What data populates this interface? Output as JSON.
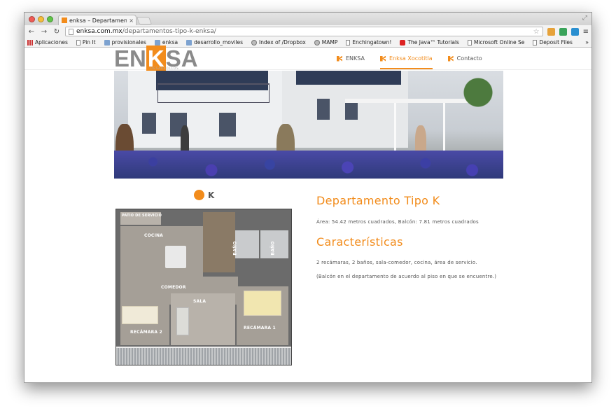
{
  "browser": {
    "tab_title": "enksa – Departamentos tip",
    "tab_close": "×",
    "url_host": "enksa.com.mx",
    "url_path": "/departamentos-tipo-k-enksa/",
    "bookmarks": [
      {
        "label": "Aplicaciones",
        "icon": "apps-icon"
      },
      {
        "label": "Pin It",
        "icon": "page-icon"
      },
      {
        "label": "provisionales",
        "icon": "folder-icon"
      },
      {
        "label": "enksa",
        "icon": "folder-icon"
      },
      {
        "label": "desarrollo_moviles",
        "icon": "folder-icon"
      },
      {
        "label": "Index of /Dropbox",
        "icon": "globe-icon"
      },
      {
        "label": "MAMP",
        "icon": "globe-icon"
      },
      {
        "label": "Enchingatown!",
        "icon": "page-icon"
      },
      {
        "label": "The Java™ Tutorials",
        "icon": "youtube-icon"
      },
      {
        "label": "Microsoft Online Se",
        "icon": "page-icon"
      },
      {
        "label": "Deposit Files",
        "icon": "page-icon"
      }
    ],
    "bookmarks_more": "»"
  },
  "site": {
    "logo_left": "EN",
    "logo_k": "K",
    "logo_right": "SA",
    "logo_sub": "DESARROLLOS",
    "nav": [
      {
        "label": "ENKSA",
        "active": false
      },
      {
        "label": "Enksa Xocotitla",
        "active": true
      },
      {
        "label": "Contacto",
        "active": false
      }
    ],
    "accent_color": "#f28c1c"
  },
  "content": {
    "plan_letter": "K",
    "title": "Departamento Tipo K",
    "area_text": "Área: 54.42 metros cuadrados, Balcón: 7.81 metros cuadrados",
    "features_heading": "Características",
    "features_text": "2 recámaras, 2 baños, sala-comedor, cocina, área de servicio.",
    "note_text": "(Balcón en el departamento de acuerdo al piso en que se encuentre.)"
  },
  "plan_labels": {
    "patio": "PATIO DE SERVICIO",
    "cocina": "COCINA",
    "comedor": "COMEDOR",
    "sala": "SALA",
    "recamara2": "RECÁMARA 2",
    "recamara1": "RECÁMARA 1",
    "bano1": "BAÑO",
    "bano2": "BAÑO"
  }
}
